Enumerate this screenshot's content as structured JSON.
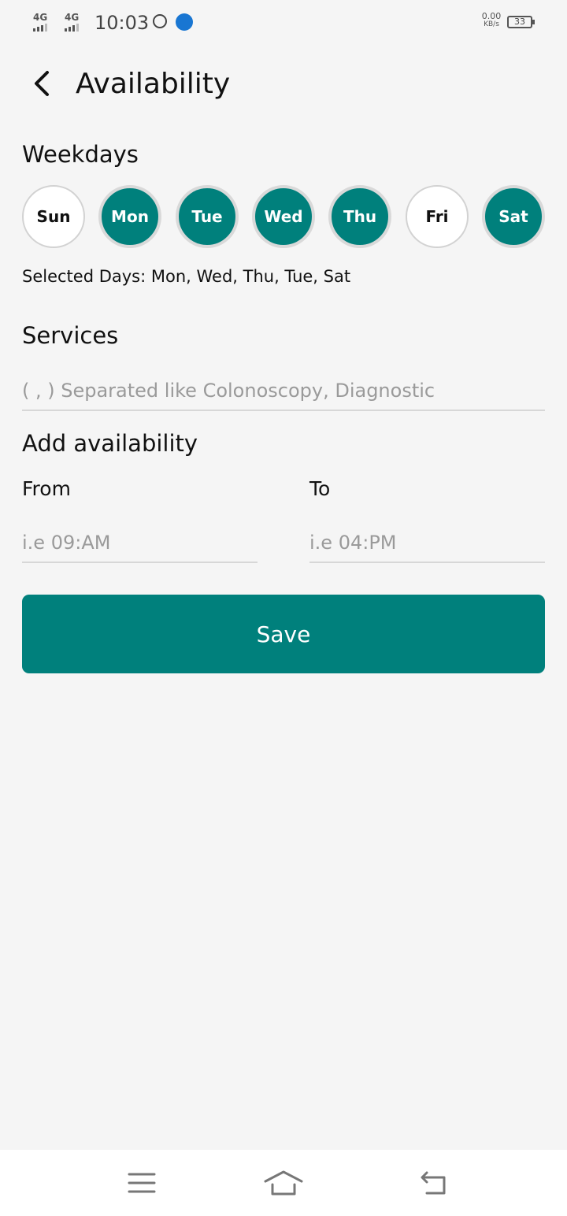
{
  "status_bar": {
    "signal1": "4G",
    "signal2": "4G",
    "time": "10:03",
    "speed_value": "0.00",
    "speed_unit": "KB/s",
    "battery": "33",
    "icons": [
      "whatsapp-icon",
      "app-notification-icon"
    ]
  },
  "header": {
    "title": "Availability",
    "back_icon": "chevron-left-icon"
  },
  "weekdays": {
    "label": "Weekdays",
    "accent_color": "#00807c",
    "days": [
      {
        "label": "Sun",
        "selected": false
      },
      {
        "label": "Mon",
        "selected": true
      },
      {
        "label": "Tue",
        "selected": true
      },
      {
        "label": "Wed",
        "selected": true
      },
      {
        "label": "Thu",
        "selected": true
      },
      {
        "label": "Fri",
        "selected": false
      },
      {
        "label": "Sat",
        "selected": true
      }
    ],
    "selected_text": "Selected Days: Mon, Wed, Thu, Tue, Sat"
  },
  "services": {
    "label": "Services",
    "value": "",
    "placeholder": "( , ) Separated like Colonoscopy, Diagnostic"
  },
  "availability": {
    "label": "Add availability",
    "from": {
      "label": "From",
      "value": "",
      "placeholder": "i.e 09:AM"
    },
    "to": {
      "label": "To",
      "value": "",
      "placeholder": "i.e 04:PM"
    }
  },
  "actions": {
    "save_label": "Save"
  },
  "nav_bar": {
    "icons": [
      "menu-icon",
      "home-icon",
      "back-icon"
    ]
  }
}
